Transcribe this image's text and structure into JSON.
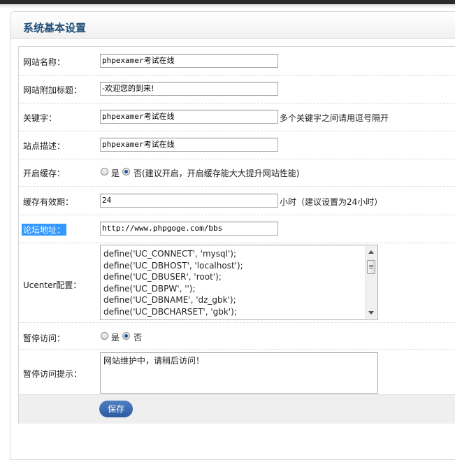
{
  "panel": {
    "title": "系统基本设置"
  },
  "form": {
    "site_name": {
      "label": "网站名称：",
      "value": "phpexamer考试在线"
    },
    "site_subtitle": {
      "label": "网站附加标题：",
      "value": "-欢迎您的到来!"
    },
    "keywords": {
      "label": "关键字：",
      "value": "phpexamer考试在线",
      "hint": "多个关键字之间请用逗号隔开"
    },
    "description": {
      "label": "站点描述：",
      "value": "phpexamer考试在线"
    },
    "cache": {
      "label": "开启缓存：",
      "options": [
        "是",
        "否"
      ],
      "selected": "否",
      "hint": "(建议开启，开启缓存能大大提升网站性能)"
    },
    "cache_ttl": {
      "label": "缓存有效期：",
      "value": "24",
      "hint": "小时（建议设置为24小时）"
    },
    "forum_url": {
      "label": "论坛地址：",
      "value": "http://www.phpgoge.com/bbs"
    },
    "ucenter": {
      "label": "Ucenter配置：",
      "lines": [
        "define('UC_CONNECT', 'mysql');",
        "define('UC_DBHOST', 'localhost');",
        "define('UC_DBUSER', 'root');",
        "define('UC_DBPW', '');",
        "define('UC_DBNAME', 'dz_gbk');",
        "define('UC_DBCHARSET', 'gbk');"
      ]
    },
    "pause": {
      "label": "暂停访问：",
      "options": [
        "是",
        "否"
      ],
      "selected": "否"
    },
    "pause_notice": {
      "label": "暂停访问提示：",
      "value": "网站维护中，请稍后访问！"
    },
    "save_label": "保存"
  }
}
